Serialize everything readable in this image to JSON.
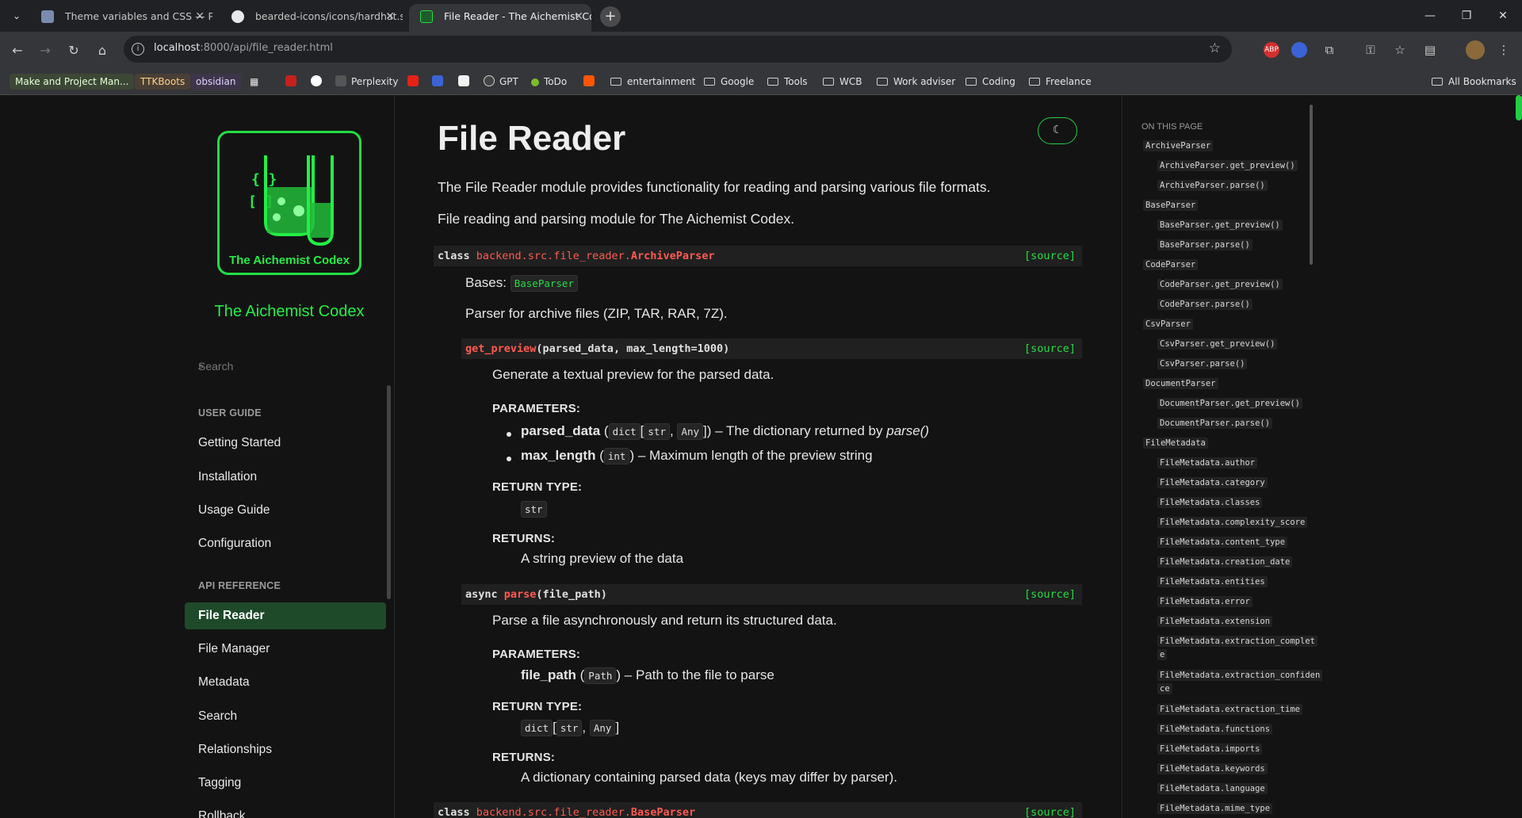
{
  "browser": {
    "tabs": [
      {
        "label": "Theme variables and CSS — Py"
      },
      {
        "label": "bearded-icons/icons/hardhat.s"
      },
      {
        "label": "File Reader - The Aichemist Co"
      }
    ],
    "url_host": "localhost",
    "url_path": ":8000/api/file_reader.html",
    "bookmarks": [
      "Make and Project Man...",
      "TTKBoots",
      "obsidian",
      "Perplexity",
      "GPT",
      "ToDo",
      "entertainment",
      "Google",
      "Tools",
      "WCB",
      "Work adviser",
      "Coding",
      "Freelance"
    ],
    "all_bookmarks": "All Bookmarks",
    "ext_abp": "ABP"
  },
  "sidebar": {
    "logo_text": "The Aichemist Codex",
    "logo_glyph_braces": "{ }",
    "logo_glyph_bracket": "[ ]",
    "project_name": "The Aichemist Codex",
    "search_placeholder": "Search",
    "user_guide_caption": "USER GUIDE",
    "user_guide": [
      "Getting Started",
      "Installation",
      "Usage Guide",
      "Configuration"
    ],
    "api_caption": "API REFERENCE",
    "api": [
      "File Reader",
      "File Manager",
      "Metadata",
      "Search",
      "Relationships",
      "Tagging",
      "Rollback"
    ]
  },
  "content": {
    "title": "File Reader",
    "intro1": "The File Reader module provides functionality for reading and parsing various file formats.",
    "intro2": "File reading and parsing module for The Aichemist Codex.",
    "source_label": "[source]",
    "class1": {
      "keyword": "class",
      "prefix": "backend.src.file_reader.",
      "name": "ArchiveParser",
      "bases_label": "Bases:",
      "bases": "BaseParser",
      "desc": "Parser for archive files (ZIP, TAR, RAR, 7Z)."
    },
    "method1": {
      "name": "get_preview",
      "params": "(parsed_data, max_length=1000)",
      "desc": "Generate a textual preview for the parsed data.",
      "params_caption": "PARAMETERS:",
      "p1_name": "parsed_data",
      "p1_type_dict": "dict",
      "p1_type_str": "str",
      "p1_type_any": "Any",
      "p1_desc": "– The dictionary returned by",
      "p1_ref": "parse()",
      "p2_name": "max_length",
      "p2_type": "int",
      "p2_desc": "– Maximum length of the preview string",
      "return_type_caption": "RETURN TYPE:",
      "return_type": "str",
      "returns_caption": "RETURNS:",
      "returns": "A string preview of the data"
    },
    "method2": {
      "prefix": "async",
      "name": "parse",
      "params": "(file_path)",
      "desc": "Parse a file asynchronously and return its structured data.",
      "params_caption": "PARAMETERS:",
      "p1_name": "file_path",
      "p1_type": "Path",
      "p1_desc": "– Path to the file to parse",
      "return_type_caption": "RETURN TYPE:",
      "rt_dict": "dict",
      "rt_str": "str",
      "rt_any": "Any",
      "returns_caption": "RETURNS:",
      "returns": "A dictionary containing parsed data (keys may differ by parser)."
    },
    "class2": {
      "keyword": "class",
      "prefix": "backend.src.file_reader.",
      "name": "BaseParser"
    }
  },
  "toc": {
    "caption": "ON THIS PAGE",
    "items": [
      {
        "text": "ArchiveParser",
        "level": 1
      },
      {
        "text": "ArchiveParser.get_preview()",
        "level": 2
      },
      {
        "text": "ArchiveParser.parse()",
        "level": 2
      },
      {
        "text": "BaseParser",
        "level": 1
      },
      {
        "text": "BaseParser.get_preview()",
        "level": 2
      },
      {
        "text": "BaseParser.parse()",
        "level": 2
      },
      {
        "text": "CodeParser",
        "level": 1
      },
      {
        "text": "CodeParser.get_preview()",
        "level": 2
      },
      {
        "text": "CodeParser.parse()",
        "level": 2
      },
      {
        "text": "CsvParser",
        "level": 1
      },
      {
        "text": "CsvParser.get_preview()",
        "level": 2
      },
      {
        "text": "CsvParser.parse()",
        "level": 2
      },
      {
        "text": "DocumentParser",
        "level": 1
      },
      {
        "text": "DocumentParser.get_preview()",
        "level": 2
      },
      {
        "text": "DocumentParser.parse()",
        "level": 2
      },
      {
        "text": "FileMetadata",
        "level": 1
      },
      {
        "text": "FileMetadata.author",
        "level": 2
      },
      {
        "text": "FileMetadata.category",
        "level": 2
      },
      {
        "text": "FileMetadata.classes",
        "level": 2
      },
      {
        "text": "FileMetadata.complexity_score",
        "level": 2
      },
      {
        "text": "FileMetadata.content_type",
        "level": 2
      },
      {
        "text": "FileMetadata.creation_date",
        "level": 2
      },
      {
        "text": "FileMetadata.entities",
        "level": 2
      },
      {
        "text": "FileMetadata.error",
        "level": 2
      },
      {
        "text": "FileMetadata.extension",
        "level": 2
      },
      {
        "text": "FileMetadata.extraction_complet",
        "cont": "e",
        "level": 2
      },
      {
        "text": "FileMetadata.extraction_confiden",
        "cont": "ce",
        "level": 2
      },
      {
        "text": "FileMetadata.extraction_time",
        "level": 2
      },
      {
        "text": "FileMetadata.functions",
        "level": 2
      },
      {
        "text": "FileMetadata.imports",
        "level": 2
      },
      {
        "text": "FileMetadata.keywords",
        "level": 2
      },
      {
        "text": "FileMetadata.language",
        "level": 2
      },
      {
        "text": "FileMetadata.mime_type",
        "level": 2
      }
    ]
  },
  "colors": {
    "accent_green": "#22dd44",
    "name_red": "#ff5a52",
    "background": "#131313"
  }
}
